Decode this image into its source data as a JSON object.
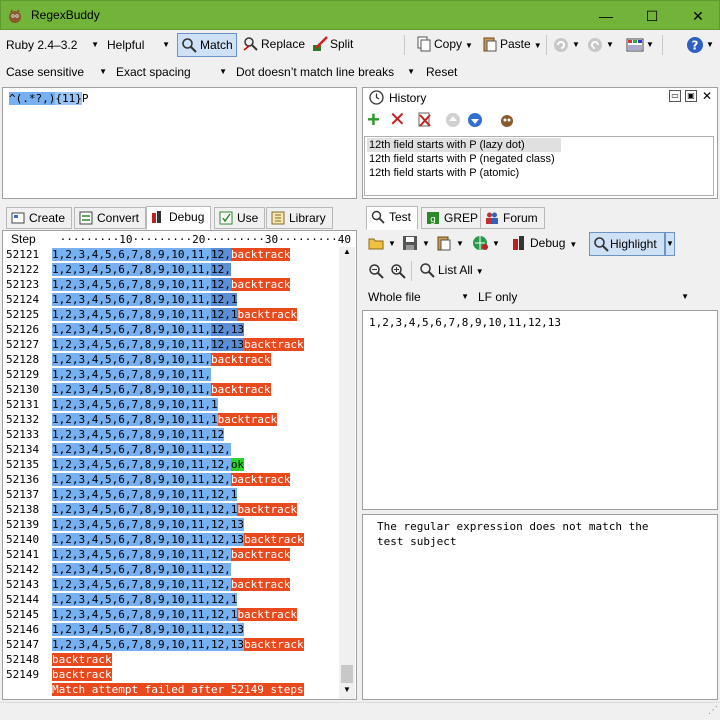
{
  "window": {
    "title": "RegexBuddy",
    "controls": {
      "minimize": "—",
      "maximize": "☐",
      "close": "✕"
    }
  },
  "toolbar1": {
    "flavor": "Ruby 2.4–3.2",
    "helpful": "Helpful",
    "match": "Match",
    "replace": "Replace",
    "split": "Split",
    "copy": "Copy",
    "paste": "Paste"
  },
  "toolbar2": {
    "case": "Case sensitive",
    "spacing": "Exact spacing",
    "dot": "Dot doesn’t match line breaks",
    "reset": "Reset"
  },
  "regex": {
    "p1": "^(.*?,)",
    "p2": "{11}",
    "p3": "P"
  },
  "history": {
    "title": "History",
    "items": [
      "12th field starts with P (lazy dot)",
      "12th field starts with P (negated class)",
      "12th field starts with P (atomic)"
    ]
  },
  "left_tabs": [
    "Create",
    "Convert",
    "Debug",
    "Use",
    "Library"
  ],
  "right_tabs": [
    "Test",
    "GREP",
    "Forum"
  ],
  "debug": {
    "step_label": "Step",
    "ruler": " ·········10·········20·········30·········40",
    "rows": [
      {
        "n": "52121",
        "a": "1,2,3,4,5,6,7,8,9,10,11,",
        "b": "12,",
        "bt": "backtrack",
        "ok": ""
      },
      {
        "n": "52122",
        "a": "1,2,3,4,5,6,7,8,9,10,11,",
        "b": "12,",
        "bt": "",
        "ok": ""
      },
      {
        "n": "52123",
        "a": "1,2,3,4,5,6,7,8,9,10,11,",
        "b": "12,",
        "bt": "backtrack",
        "ok": ""
      },
      {
        "n": "52124",
        "a": "1,2,3,4,5,6,7,8,9,10,11,",
        "b": "12,1",
        "bt": "",
        "ok": ""
      },
      {
        "n": "52125",
        "a": "1,2,3,4,5,6,7,8,9,10,11,",
        "b": "12,1",
        "bt": "backtrack",
        "ok": ""
      },
      {
        "n": "52126",
        "a": "1,2,3,4,5,6,7,8,9,10,11,",
        "b": "12,13",
        "bt": "",
        "ok": ""
      },
      {
        "n": "52127",
        "a": "1,2,3,4,5,6,7,8,9,10,11,",
        "b": "12,13",
        "bt": "backtrack",
        "ok": ""
      },
      {
        "n": "52128",
        "a": "1,2,3,4,5,6,7,8,9,10,11,",
        "b": "",
        "bt": "backtrack",
        "ok": ""
      },
      {
        "n": "52129",
        "a": "1,2,3,4,5,6,7,8,9,10,11,",
        "b": "",
        "bt": "",
        "ok": ""
      },
      {
        "n": "52130",
        "a": "1,2,3,4,5,6,7,8,9,10,11,",
        "b": "",
        "bt": "backtrack",
        "ok": ""
      },
      {
        "n": "52131",
        "a": "1,2,3,4,5,6,7,8,9,10,11,1",
        "b": "",
        "bt": "",
        "ok": ""
      },
      {
        "n": "52132",
        "a": "1,2,3,4,5,6,7,8,9,10,11,1",
        "b": "",
        "bt": "backtrack",
        "ok": ""
      },
      {
        "n": "52133",
        "a": "1,2,3,4,5,6,7,8,9,10,11,12",
        "b": "",
        "bt": "",
        "ok": ""
      },
      {
        "n": "52134",
        "a": "1,2,3,4,5,6,7,8,9,10,11,12,",
        "b": "",
        "bt": "",
        "ok": ""
      },
      {
        "n": "52135",
        "a": "1,2,3,4,5,6,7,8,9,10,11,12,",
        "b": "",
        "bt": "",
        "ok": "ok"
      },
      {
        "n": "52136",
        "a": "1,2,3,4,5,6,7,8,9,10,11,12,",
        "b": "",
        "bt": "backtrack",
        "ok": ""
      },
      {
        "n": "52137",
        "a": "1,2,3,4,5,6,7,8,9,10,11,12,1",
        "b": "",
        "bt": "",
        "ok": ""
      },
      {
        "n": "52138",
        "a": "1,2,3,4,5,6,7,8,9,10,11,12,1",
        "b": "",
        "bt": "backtrack",
        "ok": ""
      },
      {
        "n": "52139",
        "a": "1,2,3,4,5,6,7,8,9,10,11,12,13",
        "b": "",
        "bt": "",
        "ok": ""
      },
      {
        "n": "52140",
        "a": "1,2,3,4,5,6,7,8,9,10,11,12,13",
        "b": "",
        "bt": "backtrack",
        "ok": ""
      },
      {
        "n": "52141",
        "a": "1,2,3,4,5,6,7,8,9,10,11,12,",
        "b": "",
        "bt": "backtrack",
        "ok": ""
      },
      {
        "n": "52142",
        "a": "1,2,3,4,5,6,7,8,9,10,11,12,",
        "b": "",
        "bt": "",
        "ok": ""
      },
      {
        "n": "52143",
        "a": "1,2,3,4,5,6,7,8,9,10,11,12,",
        "b": "",
        "bt": "backtrack",
        "ok": ""
      },
      {
        "n": "52144",
        "a": "1,2,3,4,5,6,7,8,9,10,11,12,1",
        "b": "",
        "bt": "",
        "ok": ""
      },
      {
        "n": "52145",
        "a": "1,2,3,4,5,6,7,8,9,10,11,12,1",
        "b": "",
        "bt": "backtrack",
        "ok": ""
      },
      {
        "n": "52146",
        "a": "1,2,3,4,5,6,7,8,9,10,11,12,13",
        "b": "",
        "bt": "",
        "ok": ""
      },
      {
        "n": "52147",
        "a": "1,2,3,4,5,6,7,8,9,10,11,12,13",
        "b": "",
        "bt": "backtrack",
        "ok": ""
      },
      {
        "n": "52148",
        "a": "",
        "b": "",
        "bt": "backtrack",
        "ok": ""
      },
      {
        "n": "52149",
        "a": "",
        "b": "",
        "bt": "backtrack",
        "ok": ""
      },
      {
        "n": "",
        "a": "",
        "b": "",
        "bt": "Match attempt failed after 52149 steps",
        "ok": ""
      }
    ]
  },
  "test_toolbar": {
    "debug": "Debug",
    "highlight": "Highlight",
    "list_all": "List All"
  },
  "test_options": {
    "scope": "Whole file",
    "line_breaks": "LF only"
  },
  "test_subject": "1,2,3,4,5,6,7,8,9,10,11,12,13",
  "result_message": "The regular expression does not match the\ntest subject",
  "colors": {
    "titlebar": "#72b339",
    "match_blue": "#77b0f0",
    "group_blue": "#5a8fd8",
    "backtrack_red": "#e8491d",
    "ok_green": "#27d427"
  }
}
